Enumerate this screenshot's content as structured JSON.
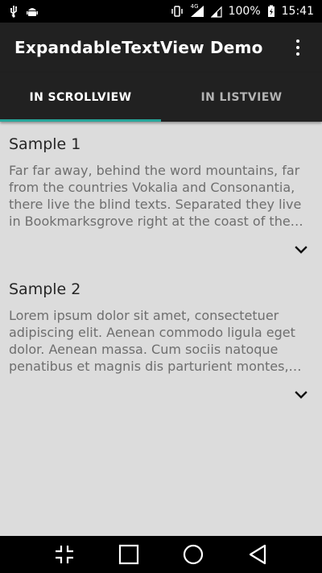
{
  "status_bar": {
    "battery_percent": "100%",
    "time": "15:41",
    "network_type": "4G",
    "left_icons": [
      "usb-icon",
      "android-debug-icon"
    ],
    "right_icons": [
      "vibrate-icon",
      "signal-4g-icon",
      "signal-2-icon",
      "battery-charging-icon"
    ]
  },
  "app_bar": {
    "title": "ExpandableTextView Demo",
    "overflow_icon": "more-vert-icon"
  },
  "tabs": [
    {
      "label": "IN SCROLLVIEW",
      "active": true
    },
    {
      "label": "IN LISTVIEW",
      "active": false
    }
  ],
  "samples": [
    {
      "title": "Sample 1",
      "text": "Far far away, behind the word mountains, far from the countries Vokalia and Consonantia, there live the blind texts. Separated they live in Bookmarksgrove right at the coast of the Semantics, a large language ocean.",
      "expand_icon": "chevron-down-icon"
    },
    {
      "title": "Sample 2",
      "text": "Lorem ipsum dolor sit amet, consectetuer adipiscing elit. Aenean commodo ligula eget dolor. Aenean massa. Cum sociis natoque penatibus et magnis dis parturient montes, nascetur ridiculus mus.",
      "expand_icon": "chevron-down-icon"
    }
  ],
  "nav_bar": {
    "buttons": [
      "recents-collapse-icon",
      "square-icon",
      "circle-home-icon",
      "triangle-back-icon"
    ]
  },
  "colors": {
    "app_bar": "#212121",
    "tab_indicator": "#26a69a",
    "background": "#dcdcdc"
  }
}
